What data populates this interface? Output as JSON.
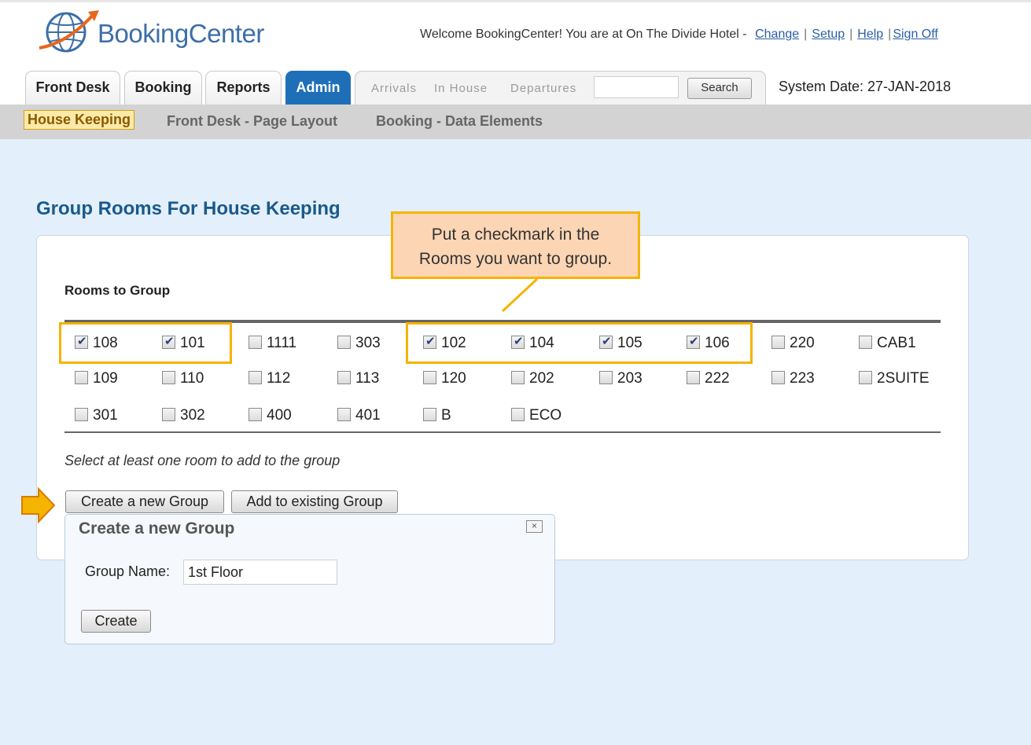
{
  "header": {
    "logo_text": "BookingCenter",
    "welcome_text": "Welcome BookingCenter! You are at On The Divide Hotel -",
    "links": [
      "Change",
      "Setup",
      "Help",
      "Sign Off"
    ],
    "system_date": "System Date: 27-JAN-2018"
  },
  "tabs": [
    "Front Desk",
    "Booking",
    "Reports",
    "Admin"
  ],
  "active_tab": "Admin",
  "quick_links": [
    "Arrivals",
    "In House",
    "Departures"
  ],
  "search_button": "Search",
  "subnav": [
    "House Keeping",
    "Front Desk - Page Layout",
    "Booking - Data Elements"
  ],
  "page_title": "Group Rooms For House Keeping",
  "rooms_label": "Rooms to Group",
  "rooms": [
    {
      "label": "108",
      "checked": true
    },
    {
      "label": "101",
      "checked": true
    },
    {
      "label": "1111",
      "checked": false
    },
    {
      "label": "303",
      "checked": false
    },
    {
      "label": "102",
      "checked": true
    },
    {
      "label": "104",
      "checked": true
    },
    {
      "label": "105",
      "checked": true
    },
    {
      "label": "106",
      "checked": true
    },
    {
      "label": "220",
      "checked": false
    },
    {
      "label": "CAB1",
      "checked": false
    },
    {
      "label": "109",
      "checked": false
    },
    {
      "label": "110",
      "checked": false
    },
    {
      "label": "112",
      "checked": false
    },
    {
      "label": "113",
      "checked": false
    },
    {
      "label": "120",
      "checked": false
    },
    {
      "label": "202",
      "checked": false
    },
    {
      "label": "203",
      "checked": false
    },
    {
      "label": "222",
      "checked": false
    },
    {
      "label": "223",
      "checked": false
    },
    {
      "label": "2SUITE",
      "checked": false
    },
    {
      "label": "301",
      "checked": false
    },
    {
      "label": "302",
      "checked": false
    },
    {
      "label": "400",
      "checked": false
    },
    {
      "label": "401",
      "checked": false
    },
    {
      "label": "B",
      "checked": false
    },
    {
      "label": "ECO",
      "checked": false
    }
  ],
  "hint": "Select at least one room to add to the group",
  "buttons": {
    "create_group": "Create a new Group",
    "add_existing": "Add to existing Group"
  },
  "dialog": {
    "title": "Create a new Group",
    "close_symbol": "×",
    "group_name_label": "Group Name:",
    "group_name_value": "1st Floor",
    "create_button": "Create"
  },
  "callout": {
    "line1": "Put a checkmark in the",
    "line2": "Rooms you want to group."
  },
  "colors": {
    "accent": "#1f6fb8",
    "highlight": "#f4b400",
    "callout_fill": "#fcd5b4",
    "page_bg": "#e3effb"
  }
}
